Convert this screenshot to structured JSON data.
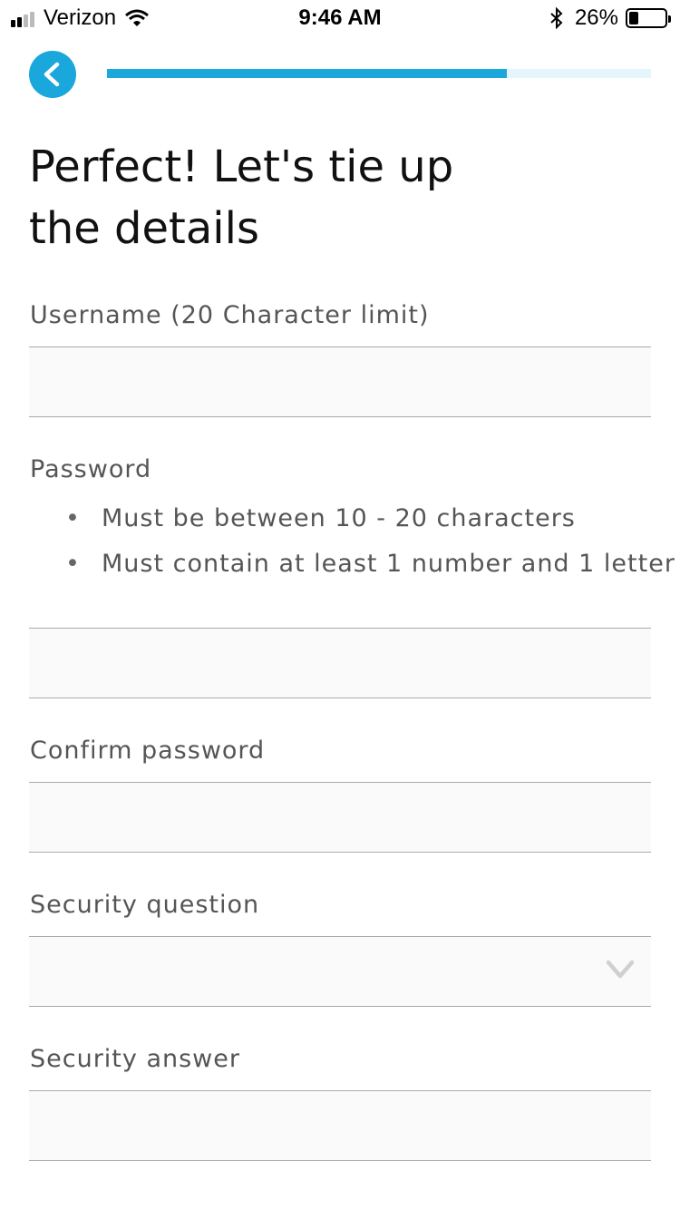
{
  "status_bar": {
    "carrier": "Verizon",
    "time": "9:46 AM",
    "battery_text": "26%",
    "battery_level": 0.26
  },
  "progress": {
    "value": 0.735
  },
  "colors": {
    "accent": "#1aa7dc",
    "accent_light": "#e5f5fc",
    "field_bg": "#fafafa"
  },
  "icons": {
    "back": "chevron-left-icon",
    "dropdown": "chevron-down-icon",
    "wifi": "wifi-icon",
    "bluetooth": "bluetooth-icon",
    "battery": "battery-icon",
    "signal": "signal-icon"
  },
  "title_line1": "Perfect! Let's tie up",
  "title_line2": "the details",
  "form": {
    "username_label": "Username (20 Character limit)",
    "password_label": "Password",
    "password_rules": [
      "Must be between 10 - 20 characters",
      "Must contain at least 1 number and 1 letter"
    ],
    "confirm_label": "Confirm password",
    "security_question_label": "Security question",
    "security_answer_label": "Security answer"
  }
}
